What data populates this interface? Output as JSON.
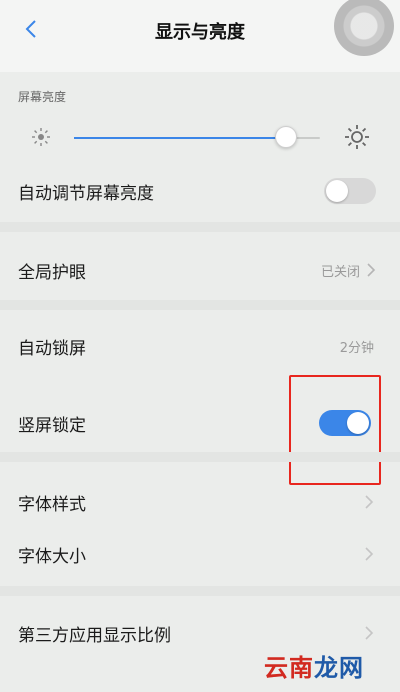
{
  "header": {
    "title": "显示与亮度",
    "back_icon": "chevron-left-icon"
  },
  "brightness": {
    "section_label": "屏幕亮度",
    "level_fraction": 0.86
  },
  "items": {
    "auto_brightness": {
      "label": "自动调节屏幕亮度",
      "state": "off"
    },
    "eye_protection": {
      "label": "全局护眼",
      "value": "已关闭"
    },
    "auto_lock": {
      "label": "自动锁屏",
      "value": "2分钟"
    },
    "portrait_lock": {
      "label": "竖屏锁定",
      "state": "on"
    },
    "font_style": {
      "label": "字体样式"
    },
    "font_size": {
      "label": "字体大小"
    },
    "third_party_ratio": {
      "label": "第三方应用显示比例"
    }
  },
  "colors": {
    "accent": "#3b86e8",
    "highlight": "#e8261e"
  },
  "watermark": {
    "part1": "云南",
    "part2": "龙网"
  }
}
